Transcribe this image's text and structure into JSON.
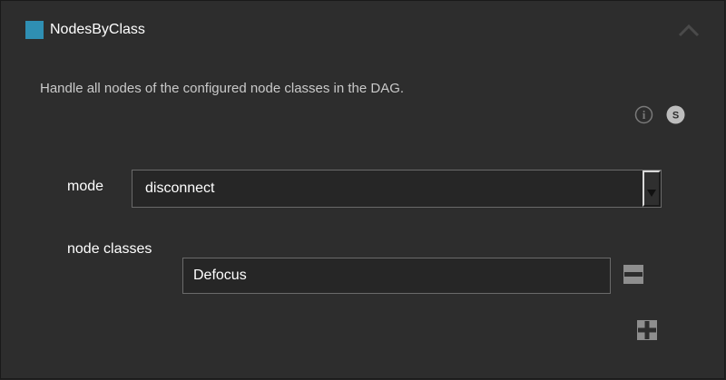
{
  "header": {
    "title": "NodesByClass",
    "accent_color": "#2f8fb3",
    "collapse_icon": "chevron-up-icon"
  },
  "description": "Handle all nodes of the configured node classes in the DAG.",
  "help_icons": {
    "info_icon": "info-icon",
    "info_glyph": "i",
    "s_icon": "s-badge-icon",
    "s_glyph": "S"
  },
  "form": {
    "mode_label": "mode",
    "mode_value": "disconnect",
    "mode_dropdown_icon": "dropdown-arrow-icon",
    "node_classes_label": "node classes",
    "node_classes": [
      {
        "value": "Defocus"
      }
    ],
    "remove_icon": "minus-icon",
    "add_icon": "plus-icon"
  }
}
